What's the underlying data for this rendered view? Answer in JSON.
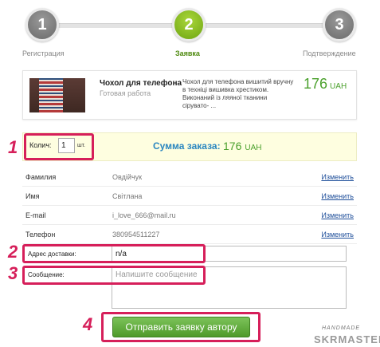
{
  "stepper": {
    "steps": [
      {
        "number": "1",
        "label": "Регистрация"
      },
      {
        "number": "2",
        "label": "Заявка"
      },
      {
        "number": "3",
        "label": "Подтверждение"
      }
    ],
    "active_step": 2
  },
  "product": {
    "title": "Чохол для телефона",
    "subtitle": "Готовая работа",
    "description": "Чохол для телефона вишитий вручну в техніці вишивка хрестиком. Виконаний із ляяної тканини сірувато- ...",
    "price": "176",
    "currency": "UAH"
  },
  "order": {
    "quantity_label": "Колич:",
    "quantity_value": "1",
    "quantity_unit": "шт.",
    "total_label": "Сумма заказа:",
    "total_value": "176",
    "total_currency": "UAH"
  },
  "info_rows": [
    {
      "label": "Фамилия",
      "value": "Овдійчук",
      "edit": "Изменить"
    },
    {
      "label": "Имя",
      "value": "Світлана",
      "edit": "Изменить"
    },
    {
      "label": "E-mail",
      "value": "i_love_666@mail.ru",
      "edit": "Изменить"
    },
    {
      "label": "Телефон",
      "value": "380954511227",
      "edit": "Изменить"
    }
  ],
  "address": {
    "label": "Адрес доставки:",
    "value": "n/a"
  },
  "message": {
    "label": "Сообщение:",
    "placeholder": "Напишите сообщение"
  },
  "submit_label": "Отправить заявку автору",
  "annotations": [
    "1",
    "2",
    "3",
    "4"
  ],
  "watermark": {
    "top": "HANDMADE",
    "bottom": "SKRMASTER"
  },
  "colors": {
    "accent_green": "#4aa02c",
    "highlight_red": "#d61f5a",
    "summary_blue": "#2a86c0",
    "link_blue": "#1f4f9a"
  }
}
